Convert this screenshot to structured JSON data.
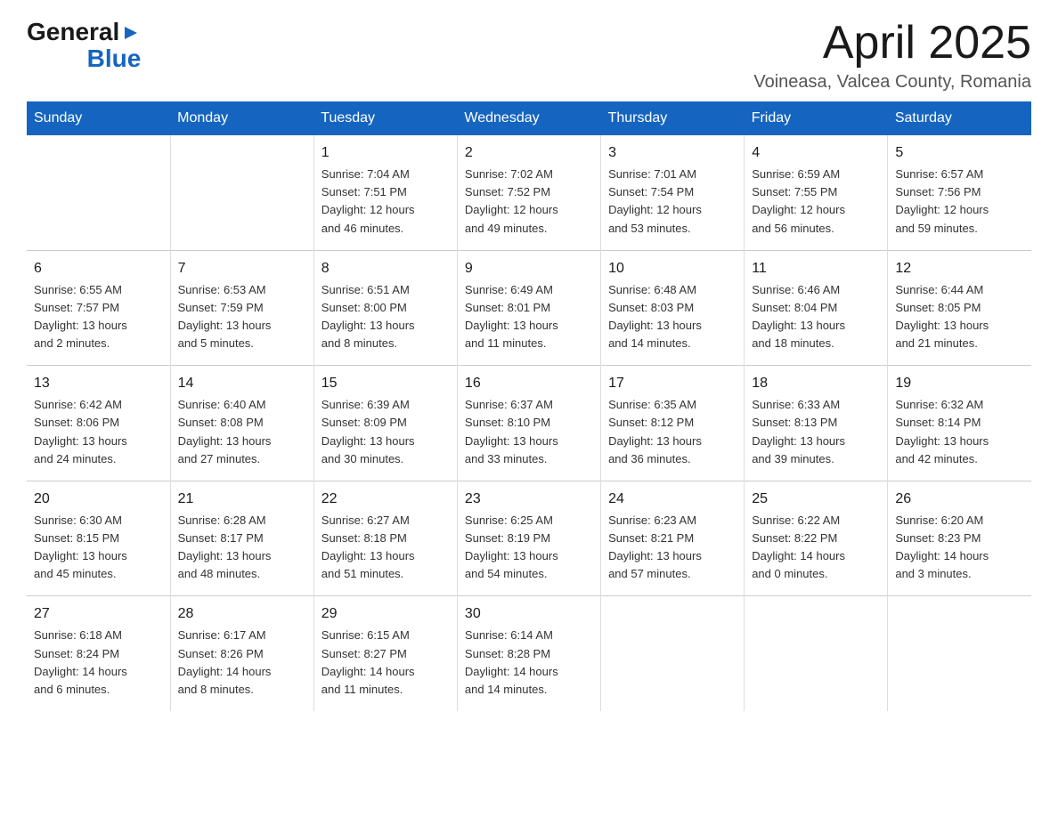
{
  "header": {
    "logo_general": "General",
    "logo_blue": "Blue",
    "title": "April 2025",
    "subtitle": "Voineasa, Valcea County, Romania"
  },
  "weekdays": [
    "Sunday",
    "Monday",
    "Tuesday",
    "Wednesday",
    "Thursday",
    "Friday",
    "Saturday"
  ],
  "weeks": [
    [
      {
        "num": "",
        "detail": ""
      },
      {
        "num": "",
        "detail": ""
      },
      {
        "num": "1",
        "detail": "Sunrise: 7:04 AM\nSunset: 7:51 PM\nDaylight: 12 hours\nand 46 minutes."
      },
      {
        "num": "2",
        "detail": "Sunrise: 7:02 AM\nSunset: 7:52 PM\nDaylight: 12 hours\nand 49 minutes."
      },
      {
        "num": "3",
        "detail": "Sunrise: 7:01 AM\nSunset: 7:54 PM\nDaylight: 12 hours\nand 53 minutes."
      },
      {
        "num": "4",
        "detail": "Sunrise: 6:59 AM\nSunset: 7:55 PM\nDaylight: 12 hours\nand 56 minutes."
      },
      {
        "num": "5",
        "detail": "Sunrise: 6:57 AM\nSunset: 7:56 PM\nDaylight: 12 hours\nand 59 minutes."
      }
    ],
    [
      {
        "num": "6",
        "detail": "Sunrise: 6:55 AM\nSunset: 7:57 PM\nDaylight: 13 hours\nand 2 minutes."
      },
      {
        "num": "7",
        "detail": "Sunrise: 6:53 AM\nSunset: 7:59 PM\nDaylight: 13 hours\nand 5 minutes."
      },
      {
        "num": "8",
        "detail": "Sunrise: 6:51 AM\nSunset: 8:00 PM\nDaylight: 13 hours\nand 8 minutes."
      },
      {
        "num": "9",
        "detail": "Sunrise: 6:49 AM\nSunset: 8:01 PM\nDaylight: 13 hours\nand 11 minutes."
      },
      {
        "num": "10",
        "detail": "Sunrise: 6:48 AM\nSunset: 8:03 PM\nDaylight: 13 hours\nand 14 minutes."
      },
      {
        "num": "11",
        "detail": "Sunrise: 6:46 AM\nSunset: 8:04 PM\nDaylight: 13 hours\nand 18 minutes."
      },
      {
        "num": "12",
        "detail": "Sunrise: 6:44 AM\nSunset: 8:05 PM\nDaylight: 13 hours\nand 21 minutes."
      }
    ],
    [
      {
        "num": "13",
        "detail": "Sunrise: 6:42 AM\nSunset: 8:06 PM\nDaylight: 13 hours\nand 24 minutes."
      },
      {
        "num": "14",
        "detail": "Sunrise: 6:40 AM\nSunset: 8:08 PM\nDaylight: 13 hours\nand 27 minutes."
      },
      {
        "num": "15",
        "detail": "Sunrise: 6:39 AM\nSunset: 8:09 PM\nDaylight: 13 hours\nand 30 minutes."
      },
      {
        "num": "16",
        "detail": "Sunrise: 6:37 AM\nSunset: 8:10 PM\nDaylight: 13 hours\nand 33 minutes."
      },
      {
        "num": "17",
        "detail": "Sunrise: 6:35 AM\nSunset: 8:12 PM\nDaylight: 13 hours\nand 36 minutes."
      },
      {
        "num": "18",
        "detail": "Sunrise: 6:33 AM\nSunset: 8:13 PM\nDaylight: 13 hours\nand 39 minutes."
      },
      {
        "num": "19",
        "detail": "Sunrise: 6:32 AM\nSunset: 8:14 PM\nDaylight: 13 hours\nand 42 minutes."
      }
    ],
    [
      {
        "num": "20",
        "detail": "Sunrise: 6:30 AM\nSunset: 8:15 PM\nDaylight: 13 hours\nand 45 minutes."
      },
      {
        "num": "21",
        "detail": "Sunrise: 6:28 AM\nSunset: 8:17 PM\nDaylight: 13 hours\nand 48 minutes."
      },
      {
        "num": "22",
        "detail": "Sunrise: 6:27 AM\nSunset: 8:18 PM\nDaylight: 13 hours\nand 51 minutes."
      },
      {
        "num": "23",
        "detail": "Sunrise: 6:25 AM\nSunset: 8:19 PM\nDaylight: 13 hours\nand 54 minutes."
      },
      {
        "num": "24",
        "detail": "Sunrise: 6:23 AM\nSunset: 8:21 PM\nDaylight: 13 hours\nand 57 minutes."
      },
      {
        "num": "25",
        "detail": "Sunrise: 6:22 AM\nSunset: 8:22 PM\nDaylight: 14 hours\nand 0 minutes."
      },
      {
        "num": "26",
        "detail": "Sunrise: 6:20 AM\nSunset: 8:23 PM\nDaylight: 14 hours\nand 3 minutes."
      }
    ],
    [
      {
        "num": "27",
        "detail": "Sunrise: 6:18 AM\nSunset: 8:24 PM\nDaylight: 14 hours\nand 6 minutes."
      },
      {
        "num": "28",
        "detail": "Sunrise: 6:17 AM\nSunset: 8:26 PM\nDaylight: 14 hours\nand 8 minutes."
      },
      {
        "num": "29",
        "detail": "Sunrise: 6:15 AM\nSunset: 8:27 PM\nDaylight: 14 hours\nand 11 minutes."
      },
      {
        "num": "30",
        "detail": "Sunrise: 6:14 AM\nSunset: 8:28 PM\nDaylight: 14 hours\nand 14 minutes."
      },
      {
        "num": "",
        "detail": ""
      },
      {
        "num": "",
        "detail": ""
      },
      {
        "num": "",
        "detail": ""
      }
    ]
  ]
}
